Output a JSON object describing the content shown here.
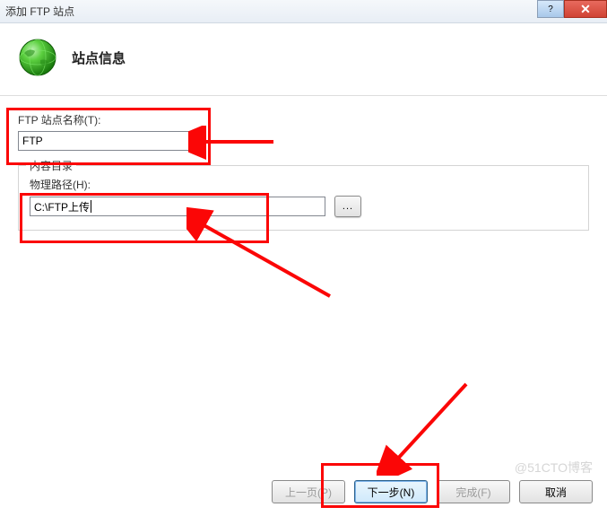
{
  "window": {
    "title": "添加 FTP 站点",
    "help_glyph": "?",
    "close_glyph": "✕"
  },
  "header": {
    "page_title": "站点信息"
  },
  "fields": {
    "site_name_label": "FTP 站点名称(T):",
    "site_name_value": "FTP"
  },
  "content_dir": {
    "group_title": "内容目录",
    "path_label": "物理路径(H):",
    "path_value": "C:\\FTP上传",
    "browse_label": "..."
  },
  "buttons": {
    "prev": "上一页(P)",
    "next": "下一步(N)",
    "finish": "完成(F)",
    "cancel": "取消"
  },
  "watermark": "@51CTO博客",
  "annotation": {
    "color": "#fb0606"
  }
}
